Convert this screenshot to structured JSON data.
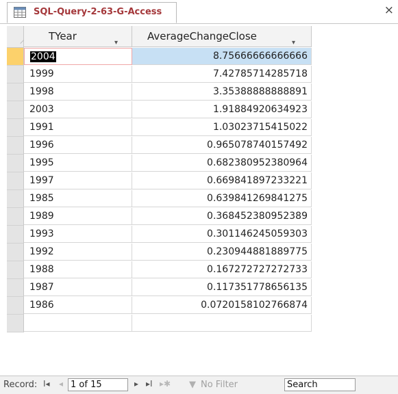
{
  "tab": {
    "title": "SQL-Query-2-63-G-Access",
    "icon": "query-datasheet-icon",
    "close_glyph": "×"
  },
  "columns": {
    "year": "TYear",
    "average": "AverageChangeClose",
    "sort_glyph": "▾"
  },
  "rows": [
    {
      "year": "2004",
      "avg": "8.75666666666666"
    },
    {
      "year": "1999",
      "avg": "7.42785714285718"
    },
    {
      "year": "1998",
      "avg": "3.35388888888891"
    },
    {
      "year": "2003",
      "avg": "1.91884920634923"
    },
    {
      "year": "1991",
      "avg": "1.03023715415022"
    },
    {
      "year": "1996",
      "avg": "0.965078740157492"
    },
    {
      "year": "1995",
      "avg": "0.682380952380964"
    },
    {
      "year": "1997",
      "avg": "0.669841897233221"
    },
    {
      "year": "1985",
      "avg": "0.639841269841275"
    },
    {
      "year": "1989",
      "avg": "0.368452380952389"
    },
    {
      "year": "1993",
      "avg": "0.301146245059303"
    },
    {
      "year": "1992",
      "avg": "0.230944881889775"
    },
    {
      "year": "1988",
      "avg": "0.167272727272733"
    },
    {
      "year": "1987",
      "avg": "0.117351778656135"
    },
    {
      "year": "1986",
      "avg": "0.0720158102766874"
    }
  ],
  "status": {
    "record_label": "Record:",
    "record_value": "1 of 15",
    "filter_label": "No Filter",
    "search_label": "Search",
    "nav_first": "I◂",
    "nav_prev": "◂",
    "nav_next": "▸",
    "nav_last": "▸I",
    "nav_new": "▸✱"
  }
}
